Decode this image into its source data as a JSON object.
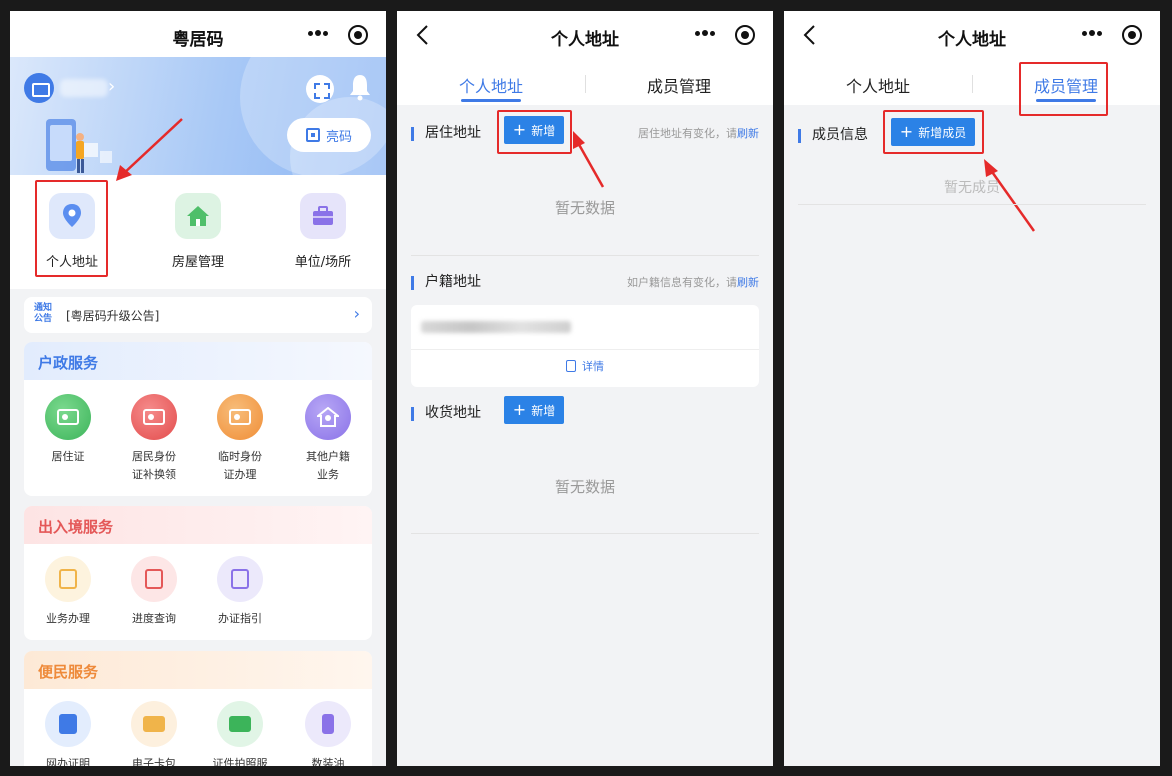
{
  "panel1": {
    "title": "粤居码",
    "light_code_label": "亮码",
    "quick_items": [
      {
        "label": "个人地址",
        "icon": "location-pin-icon"
      },
      {
        "label": "房屋管理",
        "icon": "house-icon"
      },
      {
        "label": "单位/场所",
        "icon": "briefcase-icon"
      }
    ],
    "notice": {
      "badge_line1": "通知",
      "badge_line2": "公告",
      "text": "[粤居码升级公告]"
    },
    "sections": [
      {
        "title": "户政服务",
        "accent": "#3f7ae6",
        "items": [
          {
            "label_line1": "居住证",
            "label_line2": ""
          },
          {
            "label_line1": "居民身份",
            "label_line2": "证补换领"
          },
          {
            "label_line1": "临时身份",
            "label_line2": "证办理"
          },
          {
            "label_line1": "其他户籍",
            "label_line2": "业务"
          }
        ]
      },
      {
        "title": "出入境服务",
        "accent": "#e45858",
        "items": [
          {
            "label_line1": "业务办理"
          },
          {
            "label_line1": "进度查询"
          },
          {
            "label_line1": "办证指引"
          }
        ]
      },
      {
        "title": "便民服务",
        "accent": "#ee8a3a",
        "items": [
          {
            "label_line1": "网办证明"
          },
          {
            "label_line1": "电子卡包"
          },
          {
            "label_line1": "证件拍照服"
          },
          {
            "label_line1": "数装油"
          }
        ]
      }
    ]
  },
  "panel2": {
    "title": "个人地址",
    "tabs": [
      "个人地址",
      "成员管理"
    ],
    "residence": {
      "title": "居住地址",
      "add_label": "新增",
      "hint": "居住地址有变化，请",
      "refresh": "刷新",
      "empty": "暂无数据"
    },
    "household": {
      "title": "户籍地址",
      "hint": "如户籍信息有变化，请",
      "refresh": "刷新",
      "detail": "详情"
    },
    "shipping": {
      "title": "收货地址",
      "add_label": "新增",
      "empty": "暂无数据"
    }
  },
  "panel3": {
    "title": "个人地址",
    "tabs": [
      "个人地址",
      "成员管理"
    ],
    "members": {
      "title": "成员信息",
      "add_label": "新增成员",
      "empty": "暂无成员"
    }
  },
  "colors": {
    "primary": "#3f7ae6",
    "button": "#2b82e6",
    "highlight": "#e52a2a"
  }
}
